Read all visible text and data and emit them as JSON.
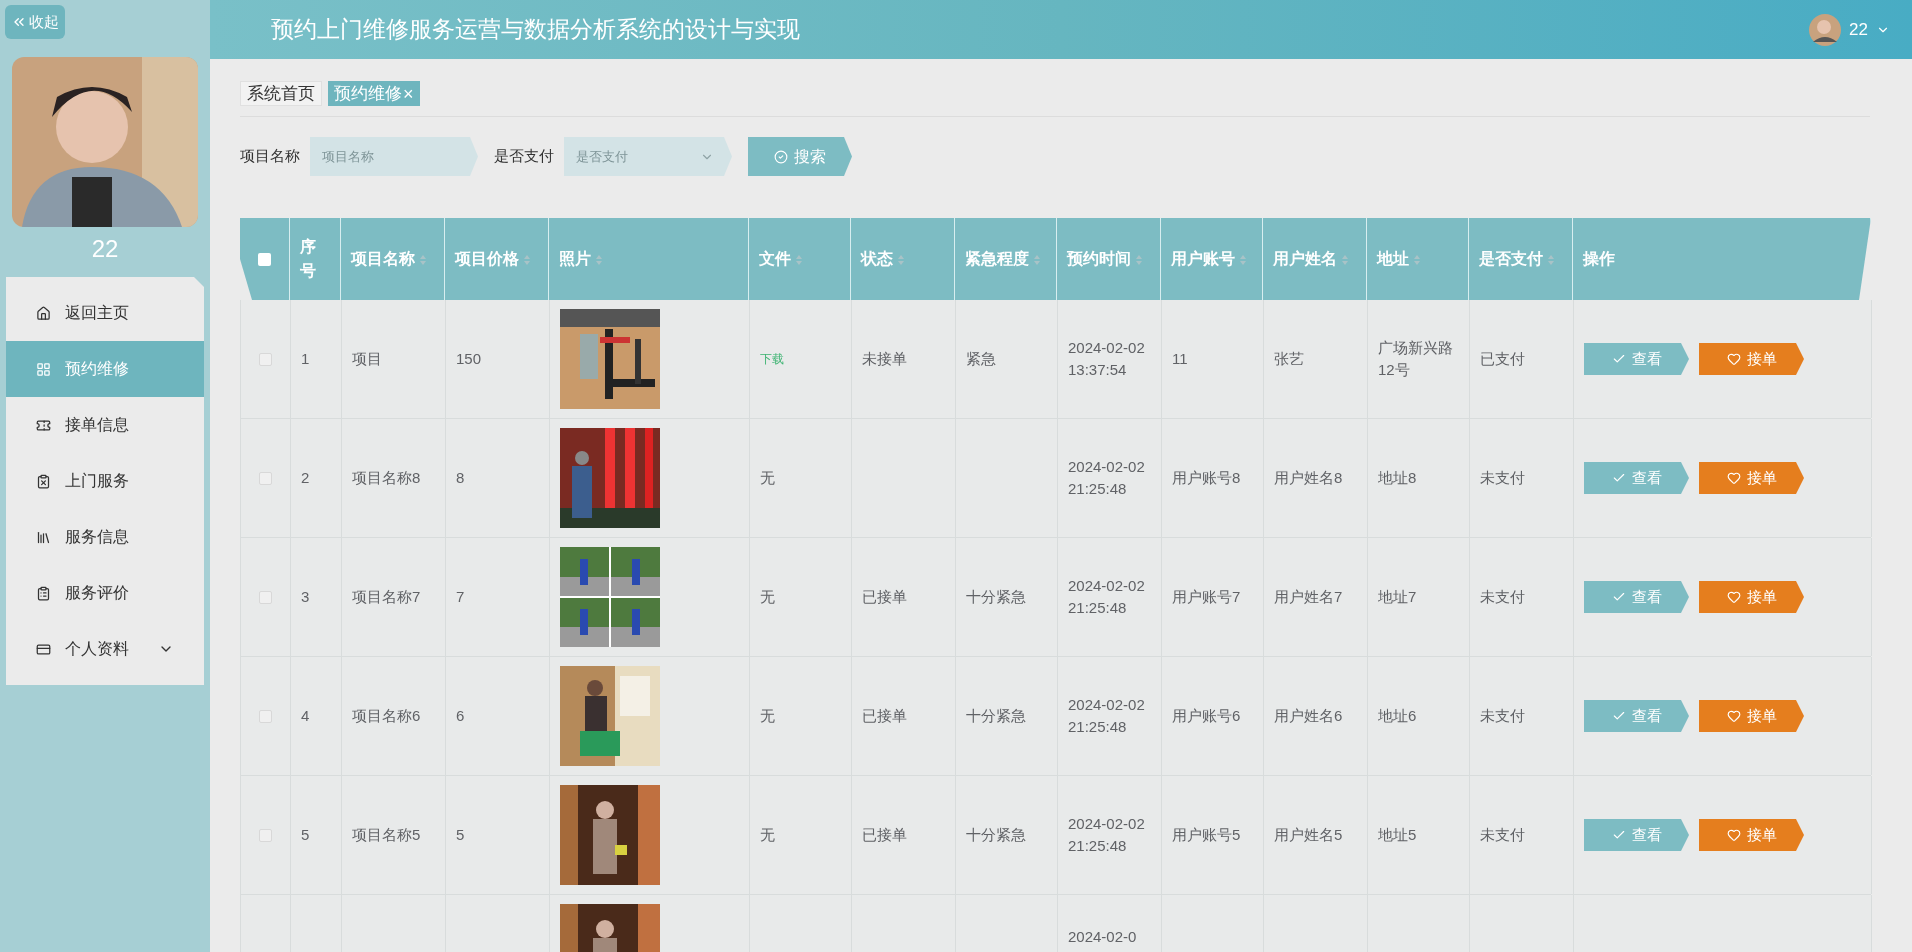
{
  "sidebar": {
    "collapse_button": "收起",
    "profile": {
      "name": "22"
    },
    "items": [
      {
        "label": "返回主页",
        "selected": false
      },
      {
        "label": "预约维修",
        "selected": true
      },
      {
        "label": "接单信息",
        "selected": false
      },
      {
        "label": "上门服务",
        "selected": false
      },
      {
        "label": "服务信息",
        "selected": false
      },
      {
        "label": "服务评价",
        "selected": false
      },
      {
        "label": "个人资料",
        "selected": false,
        "expanded": false
      }
    ]
  },
  "header": {
    "title": "预约上门维修服务运营与数据分析系统的设计与实现",
    "user": "22"
  },
  "breadcrumb_tabs": [
    {
      "label": "系统首页",
      "selected": false
    },
    {
      "label": "预约维修",
      "selected": true,
      "close": "×"
    }
  ],
  "search": {
    "fields": [
      {
        "label": "项目名称",
        "kind": "input",
        "placeholder": "项目名称"
      },
      {
        "label": "是否支付",
        "kind": "select",
        "placeholder": "是否支付"
      }
    ],
    "button": "搜索"
  },
  "table": {
    "select_all": {
      "checked": false
    },
    "columns": [
      {
        "label": "序号",
        "sortable": false
      },
      {
        "label": "项目名称",
        "sortable": true
      },
      {
        "label": "项目价格",
        "sortable": true
      },
      {
        "label": "照片",
        "sortable": true
      },
      {
        "label": "文件",
        "sortable": true
      },
      {
        "label": "状态",
        "sortable": true
      },
      {
        "label": "紧急程度",
        "sortable": true
      },
      {
        "label": "预约时间",
        "sortable": true
      },
      {
        "label": "用户账号",
        "sortable": true
      },
      {
        "label": "用户姓名",
        "sortable": true
      },
      {
        "label": "地址",
        "sortable": true
      },
      {
        "label": "是否支付",
        "sortable": true
      },
      {
        "label": "操作",
        "sortable": false
      }
    ],
    "rows": [
      {
        "checked": false,
        "no": "1",
        "name": "项目",
        "price": "150",
        "file": {
          "kind": "link",
          "text": "下载"
        },
        "status": "未接单",
        "urgency": "紧急",
        "time": "2024-02-02 13:37:54",
        "account": "11",
        "username": "张艺",
        "address": "广场新兴路12号",
        "paid": "已支付",
        "actions": [
          "查看",
          "接单"
        ]
      },
      {
        "checked": false,
        "no": "2",
        "name": "项目名称8",
        "price": "8",
        "file": {
          "kind": "text",
          "text": "无"
        },
        "time": "2024-02-02 21:25:48",
        "account": "用户账号8",
        "username": "用户姓名8",
        "address": "地址8",
        "paid": "未支付",
        "actions": [
          "查看",
          "接单"
        ]
      },
      {
        "checked": false,
        "no": "3",
        "name": "项目名称7",
        "price": "7",
        "file": {
          "kind": "text",
          "text": "无"
        },
        "status": "已接单",
        "urgency": "十分紧急",
        "time": "2024-02-02 21:25:48",
        "account": "用户账号7",
        "username": "用户姓名7",
        "address": "地址7",
        "paid": "未支付",
        "actions": [
          "查看",
          "接单"
        ]
      },
      {
        "checked": false,
        "no": "4",
        "name": "项目名称6",
        "price": "6",
        "file": {
          "kind": "text",
          "text": "无"
        },
        "status": "已接单",
        "urgency": "十分紧急",
        "time": "2024-02-02 21:25:48",
        "account": "用户账号6",
        "username": "用户姓名6",
        "address": "地址6",
        "paid": "未支付",
        "actions": [
          "查看",
          "接单"
        ]
      },
      {
        "checked": false,
        "no": "5",
        "name": "项目名称5",
        "price": "5",
        "file": {
          "kind": "text",
          "text": "无"
        },
        "status": "已接单",
        "urgency": "十分紧急",
        "time": "2024-02-02 21:25:48",
        "account": "用户账号5",
        "username": "用户姓名5",
        "address": "地址5",
        "paid": "未支付",
        "actions": [
          "查看",
          "接单"
        ]
      },
      {
        "time": "2024-02-0"
      }
    ]
  }
}
